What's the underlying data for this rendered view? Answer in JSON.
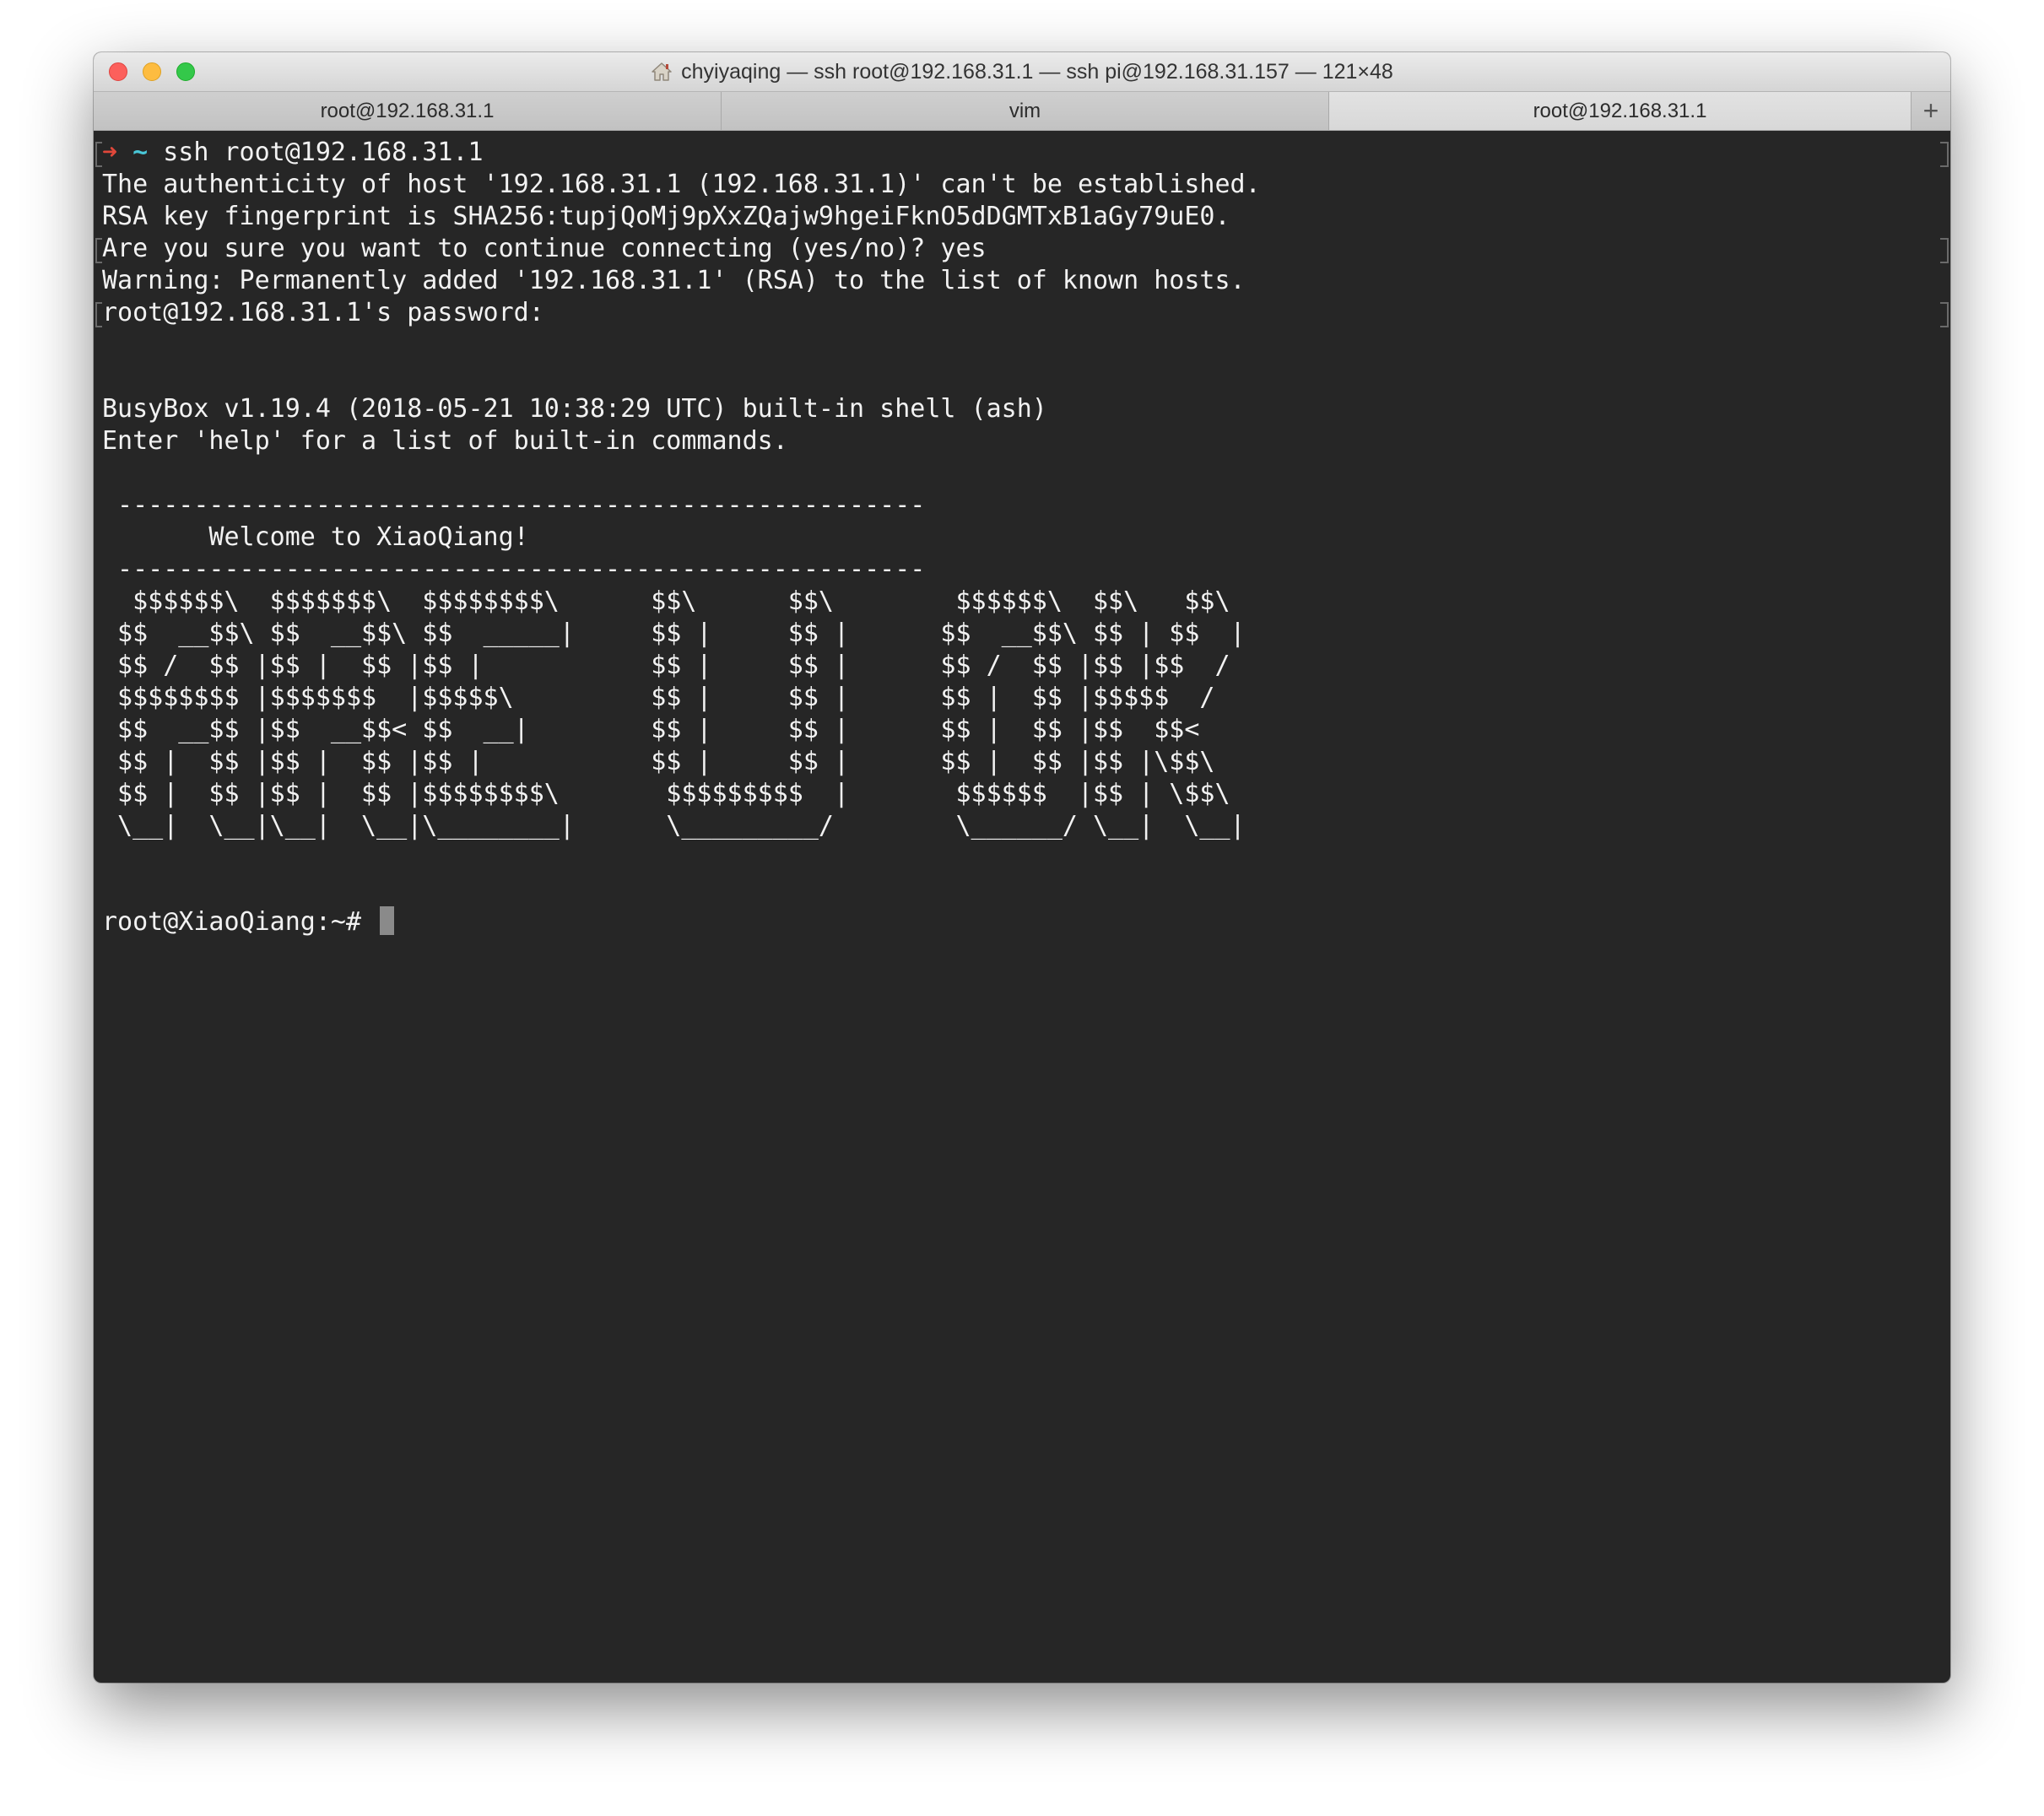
{
  "window": {
    "title": "chyiyaqing — ssh root@192.168.31.1 — ssh pi@192.168.31.157 — 121×48",
    "icons": {
      "title_icon": "home-icon",
      "add_tab": "plus-icon"
    },
    "colors": {
      "terminal_bg": "#262626",
      "terminal_fg": "#f2f2f2",
      "prompt_arrow": "#e0473a",
      "prompt_tilde": "#49c7d8"
    }
  },
  "tabs": [
    {
      "label": "root@192.168.31.1",
      "active": false
    },
    {
      "label": "vim",
      "active": false
    },
    {
      "label": "root@192.168.31.1",
      "active": true
    }
  ],
  "add_tab_label": "+",
  "terminal": {
    "prompt_arrow": "➜",
    "prompt_dir": "~",
    "command": " ssh root@192.168.31.1",
    "lines": [
      "The authenticity of host '192.168.31.1 (192.168.31.1)' can't be established.",
      "RSA key fingerprint is SHA256:tupjQoMj9pXxZQajw9hgeiFknO5dDGMTxB1aGy79uE0.",
      "Are you sure you want to continue connecting (yes/no)? yes",
      "Warning: Permanently added '192.168.31.1' (RSA) to the list of known hosts.",
      "root@192.168.31.1's password:",
      "",
      "",
      "BusyBox v1.19.4 (2018-05-21 10:38:29 UTC) built-in shell (ash)",
      "Enter 'help' for a list of built-in commands.",
      "",
      " -----------------------------------------------------",
      "       Welcome to XiaoQiang!",
      " -----------------------------------------------------",
      "  $$$$$$\\  $$$$$$$\\  $$$$$$$$\\      $$\\      $$\\        $$$$$$\\  $$\\   $$\\",
      " $$  __$$\\ $$  __$$\\ $$  _____|     $$ |     $$ |      $$  __$$\\ $$ | $$  |",
      " $$ /  $$ |$$ |  $$ |$$ |           $$ |     $$ |      $$ /  $$ |$$ |$$  /",
      " $$$$$$$$ |$$$$$$$  |$$$$$\\         $$ |     $$ |      $$ |  $$ |$$$$$  /",
      " $$  __$$ |$$  __$$< $$  __|        $$ |     $$ |      $$ |  $$ |$$  $$<",
      " $$ |  $$ |$$ |  $$ |$$ |           $$ |     $$ |      $$ |  $$ |$$ |\\$$\\",
      " $$ |  $$ |$$ |  $$ |$$$$$$$$\\       $$$$$$$$$  |       $$$$$$  |$$ | \\$$\\",
      " \\__|  \\__|\\__|  \\__|\\________|      \\_________/        \\______/ \\__|  \\__|",
      "",
      ""
    ],
    "final_prompt": "root@XiaoQiang:~# "
  }
}
